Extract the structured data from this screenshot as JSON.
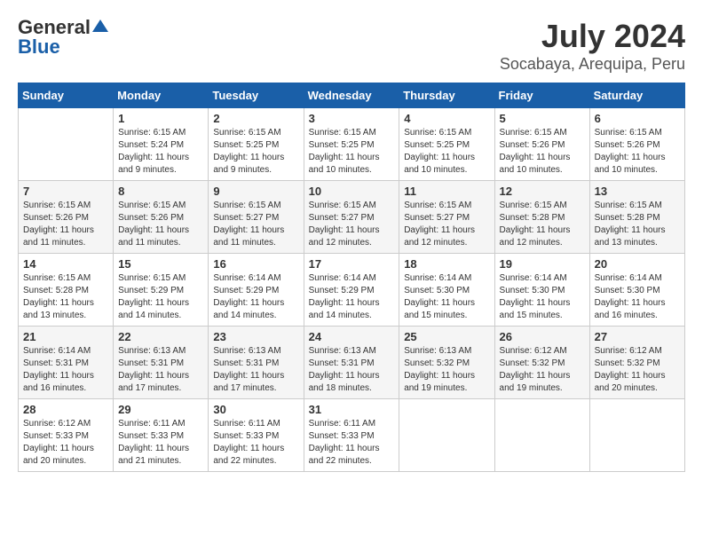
{
  "header": {
    "logo_general": "General",
    "logo_blue": "Blue",
    "month_year": "July 2024",
    "location": "Socabaya, Arequipa, Peru"
  },
  "weekdays": [
    "Sunday",
    "Monday",
    "Tuesday",
    "Wednesday",
    "Thursday",
    "Friday",
    "Saturday"
  ],
  "weeks": [
    [
      {
        "day": "",
        "info": ""
      },
      {
        "day": "1",
        "info": "Sunrise: 6:15 AM\nSunset: 5:24 PM\nDaylight: 11 hours\nand 9 minutes."
      },
      {
        "day": "2",
        "info": "Sunrise: 6:15 AM\nSunset: 5:25 PM\nDaylight: 11 hours\nand 9 minutes."
      },
      {
        "day": "3",
        "info": "Sunrise: 6:15 AM\nSunset: 5:25 PM\nDaylight: 11 hours\nand 10 minutes."
      },
      {
        "day": "4",
        "info": "Sunrise: 6:15 AM\nSunset: 5:25 PM\nDaylight: 11 hours\nand 10 minutes."
      },
      {
        "day": "5",
        "info": "Sunrise: 6:15 AM\nSunset: 5:26 PM\nDaylight: 11 hours\nand 10 minutes."
      },
      {
        "day": "6",
        "info": "Sunrise: 6:15 AM\nSunset: 5:26 PM\nDaylight: 11 hours\nand 10 minutes."
      }
    ],
    [
      {
        "day": "7",
        "info": "Sunrise: 6:15 AM\nSunset: 5:26 PM\nDaylight: 11 hours\nand 11 minutes."
      },
      {
        "day": "8",
        "info": "Sunrise: 6:15 AM\nSunset: 5:26 PM\nDaylight: 11 hours\nand 11 minutes."
      },
      {
        "day": "9",
        "info": "Sunrise: 6:15 AM\nSunset: 5:27 PM\nDaylight: 11 hours\nand 11 minutes."
      },
      {
        "day": "10",
        "info": "Sunrise: 6:15 AM\nSunset: 5:27 PM\nDaylight: 11 hours\nand 12 minutes."
      },
      {
        "day": "11",
        "info": "Sunrise: 6:15 AM\nSunset: 5:27 PM\nDaylight: 11 hours\nand 12 minutes."
      },
      {
        "day": "12",
        "info": "Sunrise: 6:15 AM\nSunset: 5:28 PM\nDaylight: 11 hours\nand 12 minutes."
      },
      {
        "day": "13",
        "info": "Sunrise: 6:15 AM\nSunset: 5:28 PM\nDaylight: 11 hours\nand 13 minutes."
      }
    ],
    [
      {
        "day": "14",
        "info": "Sunrise: 6:15 AM\nSunset: 5:28 PM\nDaylight: 11 hours\nand 13 minutes."
      },
      {
        "day": "15",
        "info": "Sunrise: 6:15 AM\nSunset: 5:29 PM\nDaylight: 11 hours\nand 14 minutes."
      },
      {
        "day": "16",
        "info": "Sunrise: 6:14 AM\nSunset: 5:29 PM\nDaylight: 11 hours\nand 14 minutes."
      },
      {
        "day": "17",
        "info": "Sunrise: 6:14 AM\nSunset: 5:29 PM\nDaylight: 11 hours\nand 14 minutes."
      },
      {
        "day": "18",
        "info": "Sunrise: 6:14 AM\nSunset: 5:30 PM\nDaylight: 11 hours\nand 15 minutes."
      },
      {
        "day": "19",
        "info": "Sunrise: 6:14 AM\nSunset: 5:30 PM\nDaylight: 11 hours\nand 15 minutes."
      },
      {
        "day": "20",
        "info": "Sunrise: 6:14 AM\nSunset: 5:30 PM\nDaylight: 11 hours\nand 16 minutes."
      }
    ],
    [
      {
        "day": "21",
        "info": "Sunrise: 6:14 AM\nSunset: 5:31 PM\nDaylight: 11 hours\nand 16 minutes."
      },
      {
        "day": "22",
        "info": "Sunrise: 6:13 AM\nSunset: 5:31 PM\nDaylight: 11 hours\nand 17 minutes."
      },
      {
        "day": "23",
        "info": "Sunrise: 6:13 AM\nSunset: 5:31 PM\nDaylight: 11 hours\nand 17 minutes."
      },
      {
        "day": "24",
        "info": "Sunrise: 6:13 AM\nSunset: 5:31 PM\nDaylight: 11 hours\nand 18 minutes."
      },
      {
        "day": "25",
        "info": "Sunrise: 6:13 AM\nSunset: 5:32 PM\nDaylight: 11 hours\nand 19 minutes."
      },
      {
        "day": "26",
        "info": "Sunrise: 6:12 AM\nSunset: 5:32 PM\nDaylight: 11 hours\nand 19 minutes."
      },
      {
        "day": "27",
        "info": "Sunrise: 6:12 AM\nSunset: 5:32 PM\nDaylight: 11 hours\nand 20 minutes."
      }
    ],
    [
      {
        "day": "28",
        "info": "Sunrise: 6:12 AM\nSunset: 5:33 PM\nDaylight: 11 hours\nand 20 minutes."
      },
      {
        "day": "29",
        "info": "Sunrise: 6:11 AM\nSunset: 5:33 PM\nDaylight: 11 hours\nand 21 minutes."
      },
      {
        "day": "30",
        "info": "Sunrise: 6:11 AM\nSunset: 5:33 PM\nDaylight: 11 hours\nand 22 minutes."
      },
      {
        "day": "31",
        "info": "Sunrise: 6:11 AM\nSunset: 5:33 PM\nDaylight: 11 hours\nand 22 minutes."
      },
      {
        "day": "",
        "info": ""
      },
      {
        "day": "",
        "info": ""
      },
      {
        "day": "",
        "info": ""
      }
    ]
  ]
}
